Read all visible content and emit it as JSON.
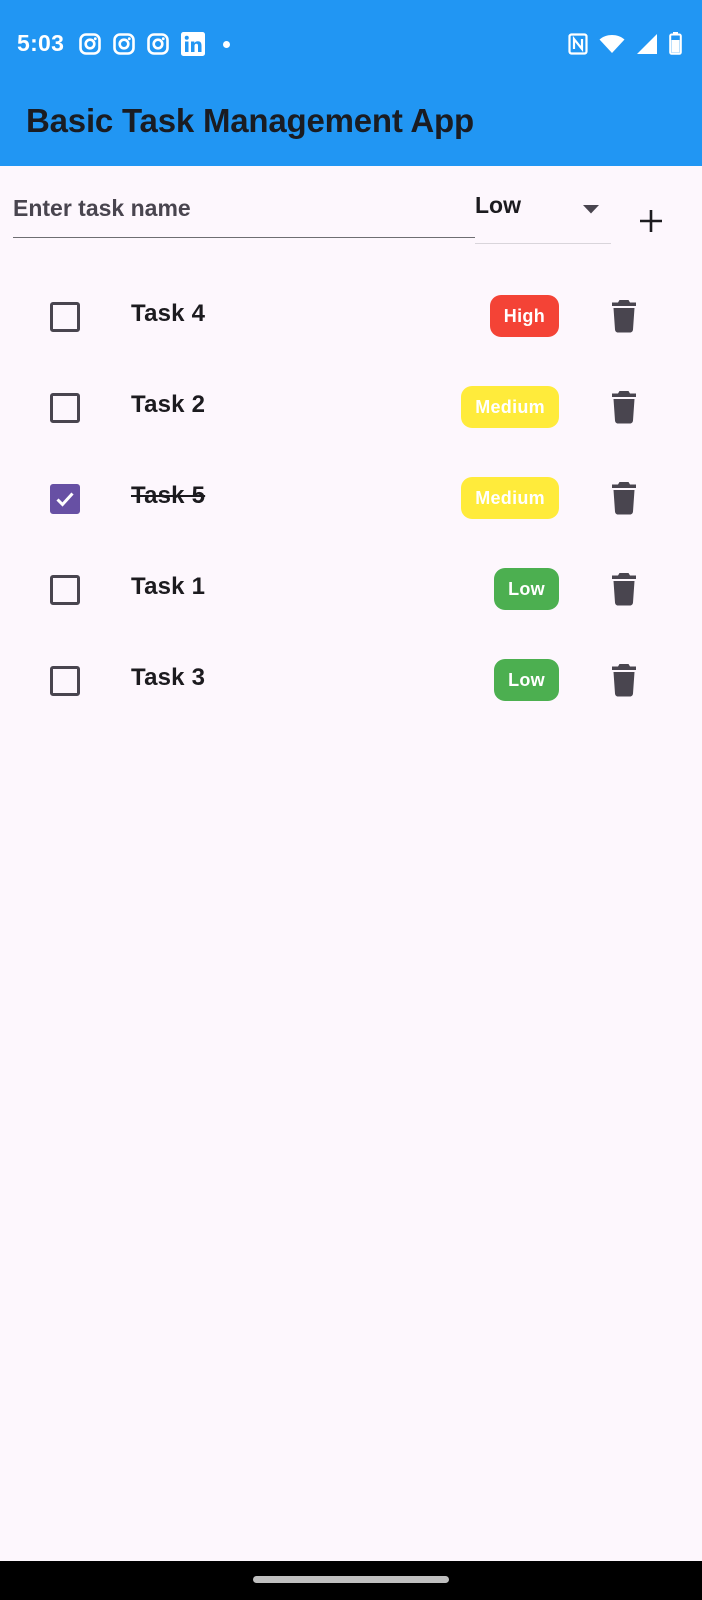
{
  "status_bar": {
    "time": "5:03",
    "left_icons": [
      "instagram-icon",
      "instagram-icon",
      "instagram-icon",
      "linkedin-icon",
      "notification-dot-icon"
    ],
    "right_icons": [
      "nfc-icon",
      "wifi-icon",
      "cellular-signal-icon",
      "battery-icon"
    ]
  },
  "app_bar": {
    "title": "Basic Task Management App",
    "background": "#2196F3"
  },
  "input": {
    "placeholder": "Enter task name",
    "value": "",
    "priority_selected": "Low",
    "add_icon": "plus-icon"
  },
  "tasks": [
    {
      "name": "Task 4",
      "done": false,
      "priority": "High",
      "color": "#F44336"
    },
    {
      "name": "Task 2",
      "done": false,
      "priority": "Medium",
      "color": "#FFEB3B"
    },
    {
      "name": "Task 5",
      "done": true,
      "priority": "Medium",
      "color": "#FFEB3B"
    },
    {
      "name": "Task 1",
      "done": false,
      "priority": "Low",
      "color": "#4CAF50"
    },
    {
      "name": "Task 3",
      "done": false,
      "priority": "Low",
      "color": "#4CAF50"
    }
  ],
  "colors": {
    "accent": "#6750A4",
    "background": "#FDF7FD",
    "high": "#F44336",
    "medium": "#FFEB3B",
    "low": "#4CAF50"
  }
}
